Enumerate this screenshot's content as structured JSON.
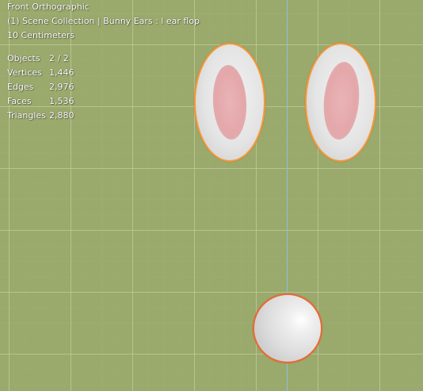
{
  "viewport": {
    "view_name": "Front Orthographic",
    "context": "(1) Scene Collection | Bunny Ears : l ear flop",
    "scale": "10 Centimeters"
  },
  "stats": [
    {
      "label": "Objects",
      "value": "2 / 2"
    },
    {
      "label": "Vertices",
      "value": "1,446"
    },
    {
      "label": "Edges",
      "value": "2,976"
    },
    {
      "label": "Faces",
      "value": "1,536"
    },
    {
      "label": "Triangles",
      "value": "2,880"
    }
  ],
  "colors": {
    "background": "#9aa96c",
    "selection_outline": "#f39a3c",
    "active_outline": "#e66a3a",
    "z_axis": "#8fc0d8"
  }
}
